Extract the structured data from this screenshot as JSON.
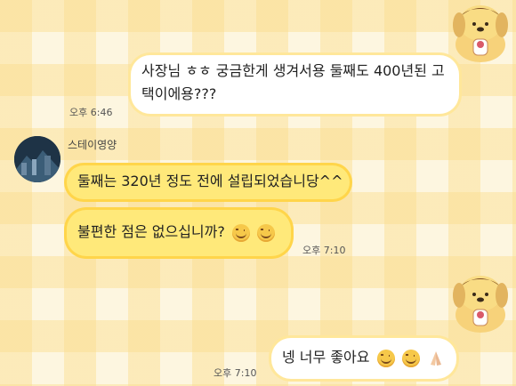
{
  "messages": [
    {
      "side": "me",
      "text_line1": "사장님 ㅎㅎ 궁금한게 생겨서용 둘째도 400년된 고",
      "text_line2": "택이에용???",
      "time": "오후 6:46"
    },
    {
      "side": "them",
      "text": "둘째는 320년 정도 전에 설립되었습니당^^"
    },
    {
      "side": "them",
      "text": "불편한 점은 없으십니까?",
      "time": "오후 7:10",
      "emojis": [
        "smiling-face-icon",
        "smiling-face-icon"
      ]
    },
    {
      "side": "me",
      "text": "넹 너무 좋아요",
      "time": "오후 7:10",
      "emojis": [
        "smiling-face-icon",
        "smiling-face-icon",
        "folded-hands-icon"
      ]
    }
  ],
  "sender": {
    "name": "스테이영양"
  },
  "stickers": [
    "pompompurin-sticker",
    "pompompurin-sticker"
  ]
}
